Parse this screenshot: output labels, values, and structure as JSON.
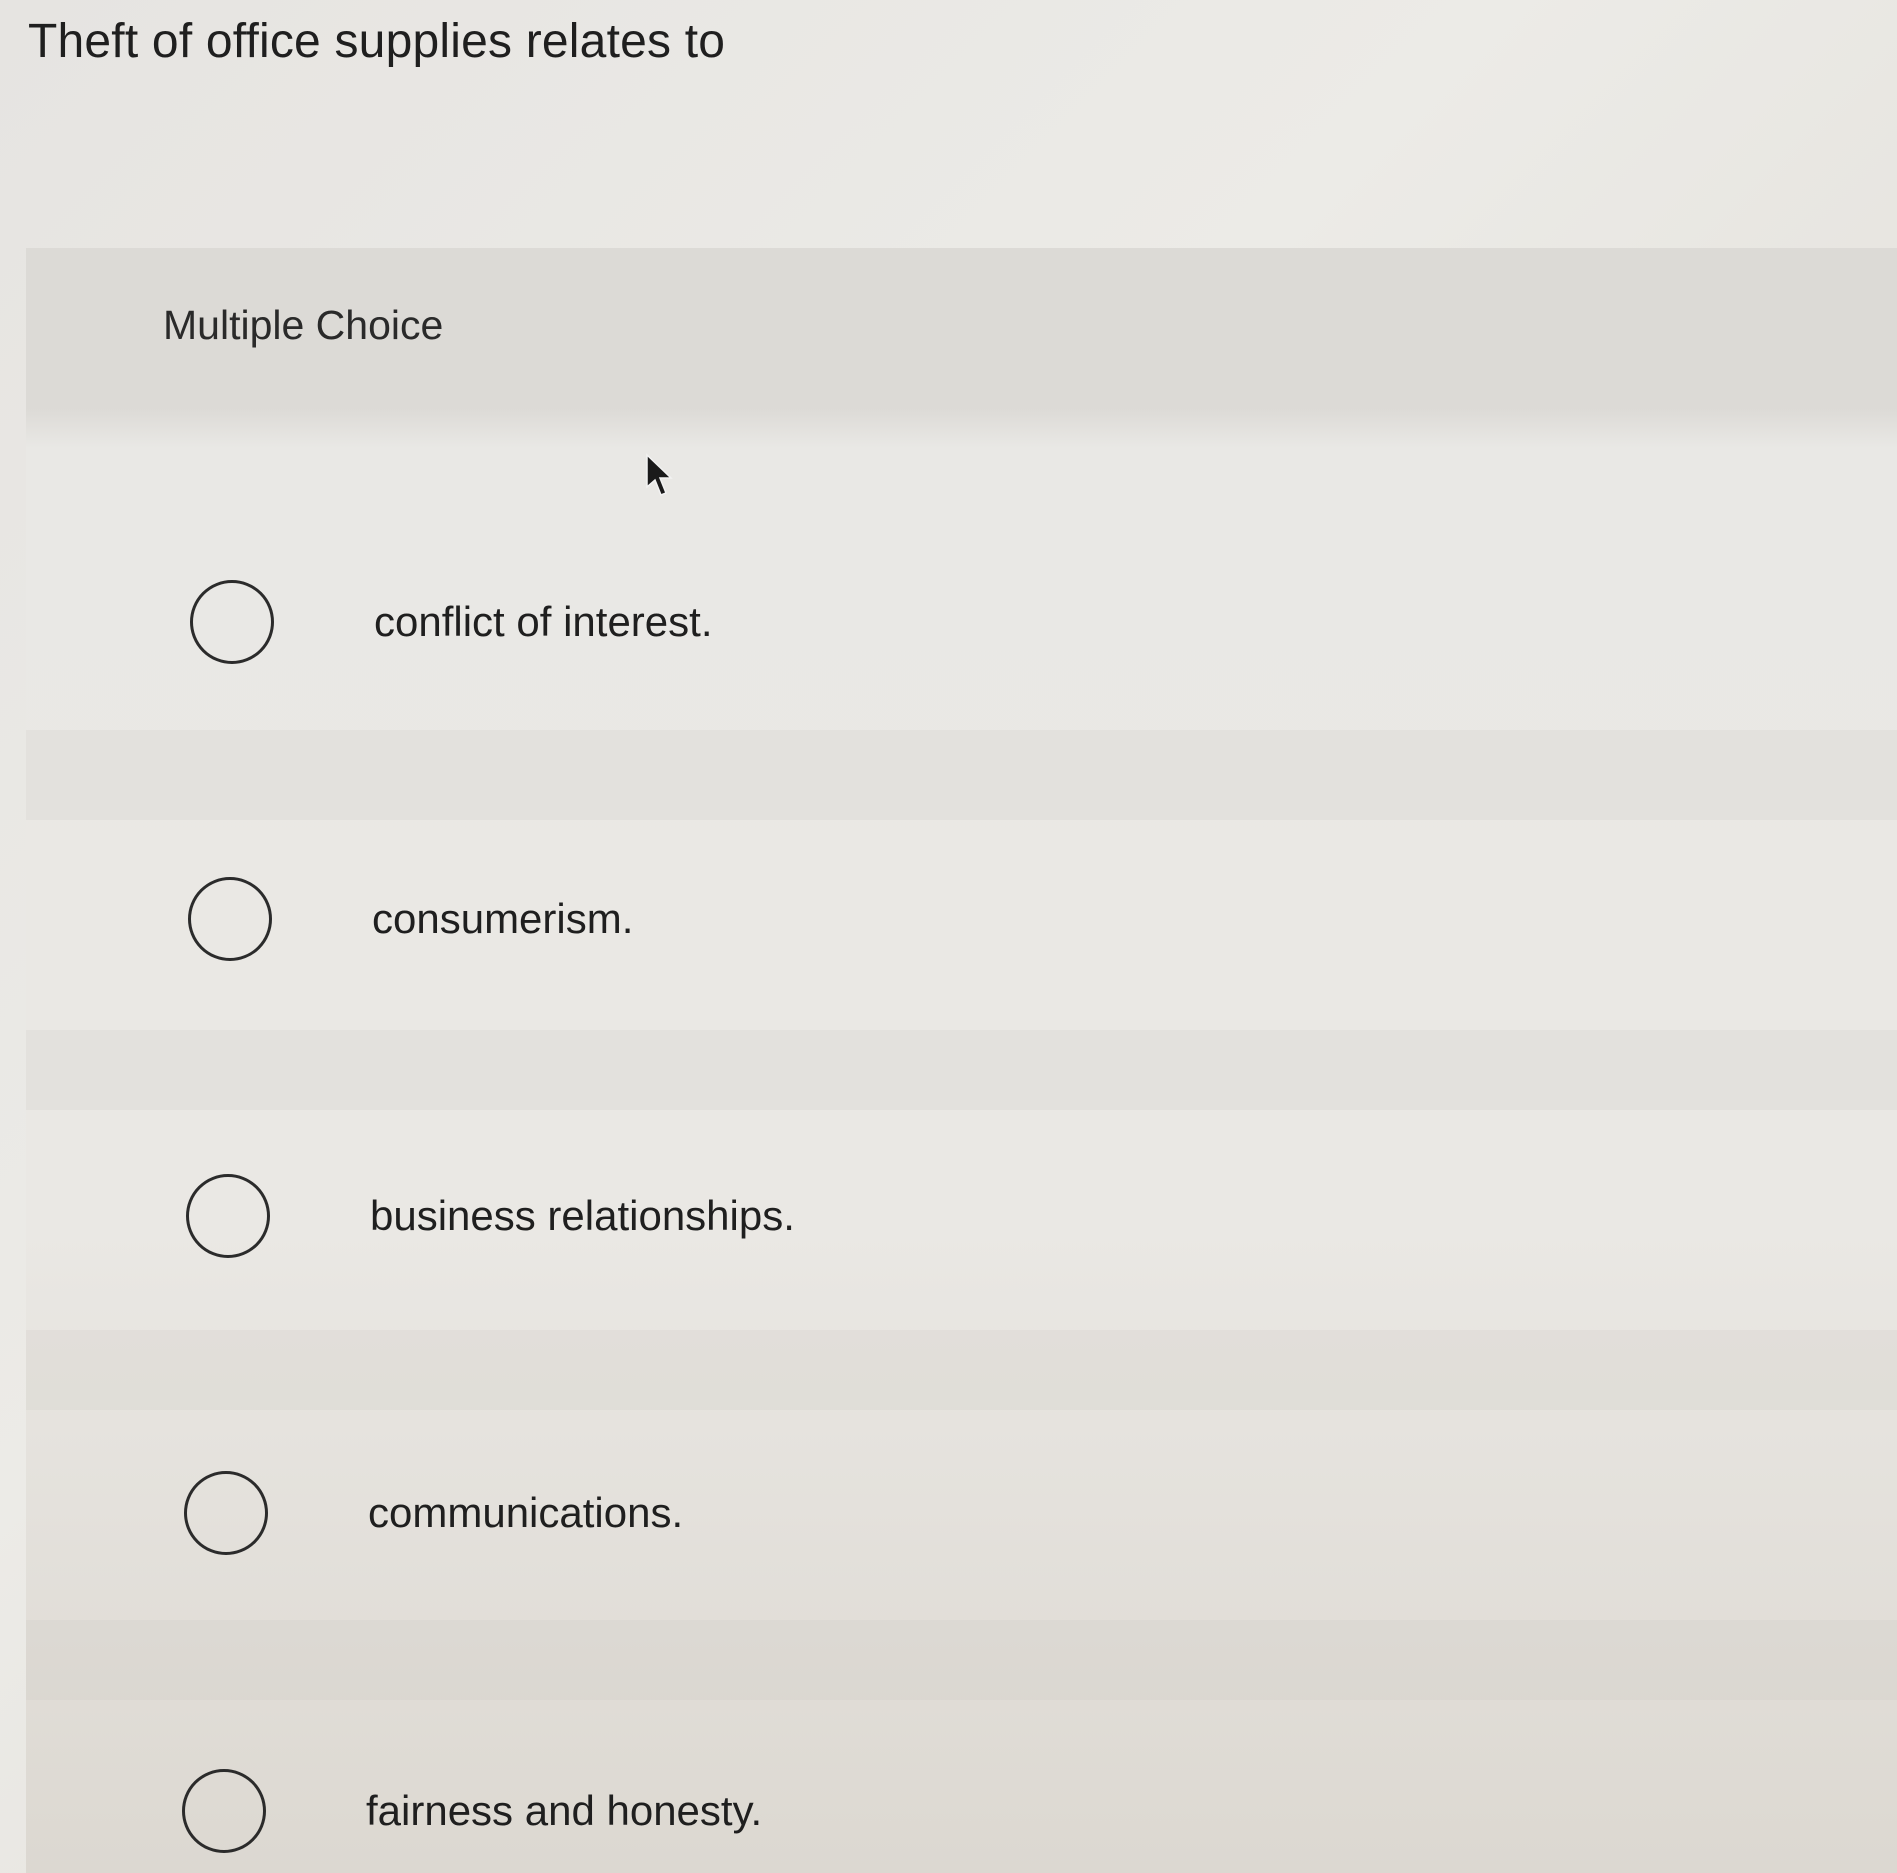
{
  "question": {
    "text": "Theft of office supplies relates to"
  },
  "section_label": "Multiple Choice",
  "options": [
    {
      "label": "conflict of interest.",
      "selected": false
    },
    {
      "label": "consumerism.",
      "selected": false
    },
    {
      "label": "business relationships.",
      "selected": false
    },
    {
      "label": "communications.",
      "selected": false
    },
    {
      "label": "fairness and honesty.",
      "selected": false
    }
  ],
  "colors": {
    "text": "#1f1f1f",
    "radio_border": "#2b2b2b",
    "panel_bg": "#e9e8e5"
  },
  "icons": {
    "cursor": "mouse-pointer-icon",
    "radio": "radio-circle-icon"
  }
}
